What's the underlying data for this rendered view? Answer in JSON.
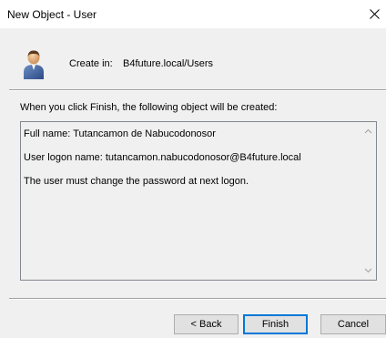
{
  "window": {
    "title": "New Object - User"
  },
  "header": {
    "create_in_label": "Create in:",
    "create_in_path": "B4future.local/Users",
    "icon": "user-icon"
  },
  "instruction": "When you click Finish, the following object will be created:",
  "summary": {
    "lines": [
      "Full name: Tutancamon de Nabucodonosor",
      "User logon name: tutancamon.nabucodonosor@B4future.local",
      "The user must change the password at next logon."
    ]
  },
  "buttons": {
    "back": "< Back",
    "finish": "Finish",
    "cancel": "Cancel"
  },
  "colors": {
    "accent_focus": "#0078d7",
    "dialog_bg": "#f0f0f0",
    "titlebar_bg": "#ffffff"
  }
}
